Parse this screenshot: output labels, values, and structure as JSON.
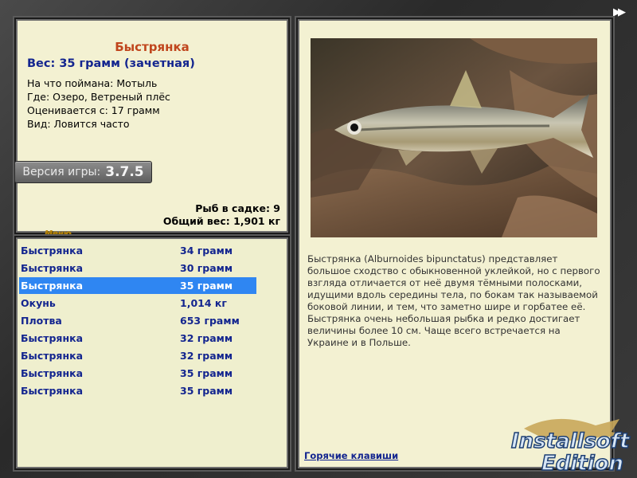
{
  "info": {
    "fish_name": "Быстрянка",
    "weight_line": "Вес: 35 грамм (зачетная)",
    "caught_on": "На что поймана: Мотыль",
    "location": "Где: Озеро, Ветреный плёс",
    "rated_from": "Оценивается с: 17 грамм",
    "kind": "Вид: Ловится часто",
    "version_label": "Версия игры:",
    "version_number": "3.7.5",
    "menu_label": "Меню",
    "cage_count": "Рыб в садке: 9",
    "cage_total_weight": "Общий вес: 1,901 кг"
  },
  "catch_list": [
    {
      "name": "Быстрянка",
      "weight": "34 грамм",
      "selected": false
    },
    {
      "name": "Быстрянка",
      "weight": "30 грамм",
      "selected": false
    },
    {
      "name": "Быстрянка",
      "weight": "35 грамм",
      "selected": true
    },
    {
      "name": "Окунь",
      "weight": "1,014 кг",
      "selected": false
    },
    {
      "name": "Плотва",
      "weight": "653 грамм",
      "selected": false
    },
    {
      "name": "Быстрянка",
      "weight": "32 грамм",
      "selected": false
    },
    {
      "name": "Быстрянка",
      "weight": "32 грамм",
      "selected": false
    },
    {
      "name": "Быстрянка",
      "weight": "35 грамм",
      "selected": false
    },
    {
      "name": "Быстрянка",
      "weight": "35 грамм",
      "selected": false
    }
  ],
  "detail": {
    "description": "Быстрянка (Alburnoides bipunctatus) представляет большое сходство с обыкновенной уклейкой, но с первого взгляда отличается от неё двумя тёмными полосками, идущими вдоль середины тела, по бокам так называемой боковой линии, и тем, что заметно шире и горбатее её. Быстрянка очень небольшая рыбка и редко достигает величины более 10 см. Чаще всего встречается на Украине и в Польше.",
    "hotkeys_link": "Горячие клавиши"
  },
  "nav": {
    "next_symbol": "▶▶"
  },
  "watermark": {
    "line1": "Installsoft",
    "line2": "Edition"
  },
  "colors": {
    "panel_bg": "#f3f1d2",
    "title_orange": "#c0461d",
    "text_navy": "#13258f",
    "selection_blue": "#2f86f2"
  }
}
